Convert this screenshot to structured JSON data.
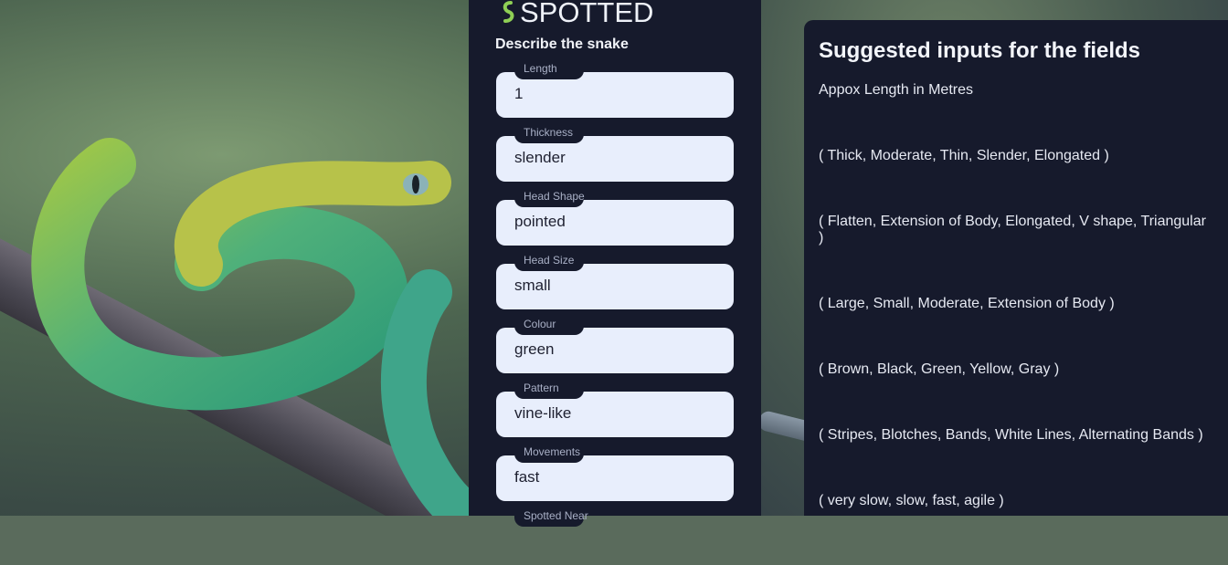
{
  "app": {
    "brand_name": "SPOTTED",
    "brand_icon": "snake-icon",
    "accent_color": "#8fcf55"
  },
  "form": {
    "heading": "Describe the snake",
    "fields": [
      {
        "label": "Length",
        "value": "1"
      },
      {
        "label": "Thickness",
        "value": "slender"
      },
      {
        "label": "Head Shape",
        "value": "pointed"
      },
      {
        "label": "Head Size",
        "value": "small"
      },
      {
        "label": "Colour",
        "value": "green"
      },
      {
        "label": "Pattern",
        "value": "vine-like"
      },
      {
        "label": "Movements",
        "value": "fast"
      },
      {
        "label": "Spotted Near",
        "value": ""
      }
    ]
  },
  "suggestions": {
    "title": "Suggested inputs for the fields",
    "items": [
      "Appox Length in Metres",
      "( Thick, Moderate, Thin, Slender, Elongated )",
      "( Flatten, Extension of Body, Elongated, V shape, Triangular )",
      "( Large, Small, Moderate, Extension of Body )",
      "( Brown, Black, Green, Yellow, Gray )",
      "( Stripes, Blotches, Bands, White Lines, Alternating Bands )",
      "( very slow, slow, fast, agile )"
    ]
  },
  "colors": {
    "panel_bg": "#161a2c",
    "input_bg": "#e8eefc"
  }
}
